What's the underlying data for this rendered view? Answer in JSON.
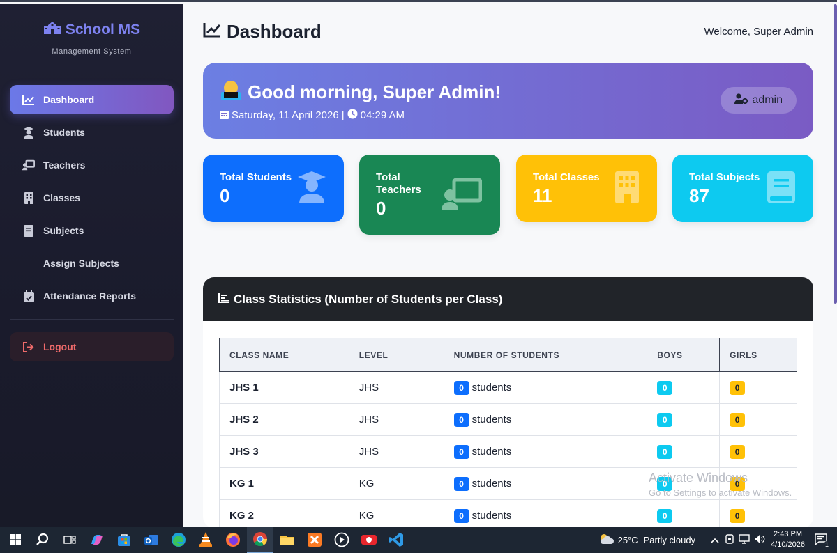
{
  "sidebar": {
    "brand": "School MS",
    "brand_sub": "Management System",
    "items": [
      {
        "label": "Dashboard",
        "icon": "chart-line-icon",
        "active": true
      },
      {
        "label": "Students",
        "icon": "graduate-icon"
      },
      {
        "label": "Teachers",
        "icon": "chalkboard-teacher-icon"
      },
      {
        "label": "Classes",
        "icon": "building-icon"
      },
      {
        "label": "Subjects",
        "icon": "book-icon"
      },
      {
        "label": "Assign Subjects",
        "icon": ""
      },
      {
        "label": "Attendance Reports",
        "icon": "calendar-check-icon"
      }
    ],
    "logout": "Logout"
  },
  "header": {
    "title": "Dashboard",
    "welcome": "Welcome, Super Admin"
  },
  "hero": {
    "greeting": "Good morning, Super Admin!",
    "date": "Saturday, 11 April 2026",
    "separator": "|",
    "time": "04:29 AM",
    "role": "admin"
  },
  "stats": [
    {
      "label": "Total Students",
      "value": "0",
      "color": "#0d6efd"
    },
    {
      "label": "Total Teachers",
      "value": "0",
      "color": "#198754"
    },
    {
      "label": "Total Classes",
      "value": "11",
      "color": "#ffc107"
    },
    {
      "label": "Total Subjects",
      "value": "87",
      "color": "#0dcaf0"
    }
  ],
  "class_stats": {
    "title": "Class Statistics (Number of Students per Class)",
    "columns": [
      "CLASS NAME",
      "LEVEL",
      "NUMBER OF STUDENTS",
      "BOYS",
      "GIRLS"
    ],
    "students_word": "students",
    "rows": [
      {
        "name": "JHS 1",
        "level": "JHS",
        "students": "0",
        "boys": "0",
        "girls": "0"
      },
      {
        "name": "JHS 2",
        "level": "JHS",
        "students": "0",
        "boys": "0",
        "girls": "0"
      },
      {
        "name": "JHS 3",
        "level": "JHS",
        "students": "0",
        "boys": "0",
        "girls": "0"
      },
      {
        "name": "KG 1",
        "level": "KG",
        "students": "0",
        "boys": "0",
        "girls": "0"
      },
      {
        "name": "KG 2",
        "level": "KG",
        "students": "0",
        "boys": "0",
        "girls": "0"
      }
    ]
  },
  "watermark": {
    "title": "Activate Windows",
    "sub": "Go to Settings to activate Windows."
  },
  "taskbar": {
    "weather_temp": "25°C",
    "weather_desc": "Partly cloudy",
    "time": "2:43 PM",
    "date": "4/10/2026",
    "notifications": "1"
  }
}
